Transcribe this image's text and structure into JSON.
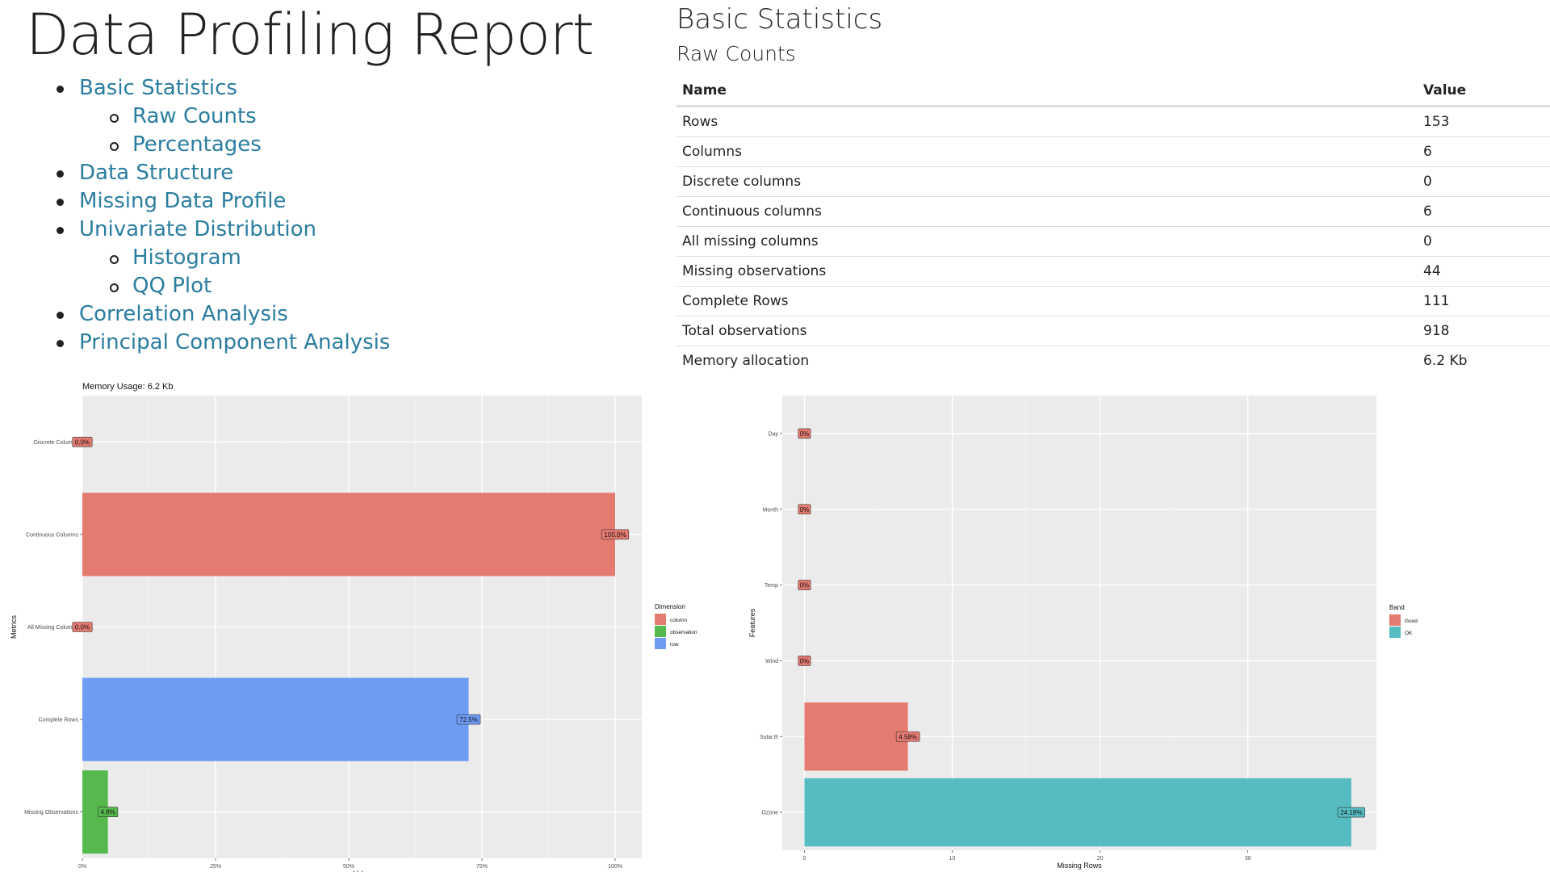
{
  "report": {
    "title": "Data Profiling Report"
  },
  "toc": [
    {
      "label": "Basic Statistics",
      "level": 1
    },
    {
      "label": "Raw Counts",
      "level": 2
    },
    {
      "label": "Percentages",
      "level": 2
    },
    {
      "label": "Data Structure",
      "level": 1
    },
    {
      "label": "Missing Data Profile",
      "level": 1
    },
    {
      "label": "Univariate Distribution",
      "level": 1
    },
    {
      "label": "Histogram",
      "level": 2
    },
    {
      "label": "QQ Plot",
      "level": 2
    },
    {
      "label": "Correlation Analysis",
      "level": 1
    },
    {
      "label": "Principal Component Analysis",
      "level": 1
    }
  ],
  "stats": {
    "heading": "Basic Statistics",
    "subheading": "Raw Counts",
    "columns": [
      "Name",
      "Value"
    ],
    "rows": [
      [
        "Rows",
        "153"
      ],
      [
        "Columns",
        "6"
      ],
      [
        "Discrete columns",
        "0"
      ],
      [
        "Continuous columns",
        "6"
      ],
      [
        "All missing columns",
        "0"
      ],
      [
        "Missing observations",
        "44"
      ],
      [
        "Complete Rows",
        "111"
      ],
      [
        "Total observations",
        "918"
      ],
      [
        "Memory allocation",
        "6.2 Kb"
      ]
    ]
  },
  "chart_data": [
    {
      "type": "bar",
      "orientation": "horizontal",
      "title": "Memory Usage: 6.2 Kb",
      "xlabel": "Value",
      "ylabel": "Metrics",
      "xlim": [
        0,
        1.05
      ],
      "x_ticks": [
        "0%",
        "25%",
        "50%",
        "75%",
        "100%"
      ],
      "x_tick_values": [
        0,
        0.25,
        0.5,
        0.75,
        1.0
      ],
      "categories": [
        "Discrete Columns",
        "Continuous Columns",
        "All Missing Columns",
        "Complete Rows",
        "Missing Observations"
      ],
      "values": [
        0.0,
        1.0,
        0.0,
        0.725,
        0.048
      ],
      "labels": [
        "0.0%",
        "100.0%",
        "0.0%",
        "72.5%",
        "4.8%"
      ],
      "groups": [
        "column",
        "column",
        "column",
        "row",
        "observation"
      ],
      "legend": {
        "title": "Dimension",
        "position": "right",
        "items": [
          {
            "name": "column",
            "color": "#E57A70"
          },
          {
            "name": "observation",
            "color": "#56B94D"
          },
          {
            "name": "row",
            "color": "#6E9CF5"
          }
        ]
      }
    },
    {
      "type": "bar",
      "orientation": "horizontal",
      "xlabel": "Missing Rows",
      "ylabel": "Features",
      "xlim": [
        -1.5,
        38.7
      ],
      "x_ticks": [
        "0",
        "10",
        "20",
        "30"
      ],
      "x_tick_values": [
        0,
        10,
        20,
        30
      ],
      "categories": [
        "Day",
        "Month",
        "Temp",
        "Wind",
        "Solar.R",
        "Ozone"
      ],
      "values": [
        0,
        0,
        0,
        0,
        7,
        37
      ],
      "labels": [
        "0%",
        "0%",
        "0%",
        "0%",
        "4.58%",
        "24.18%"
      ],
      "groups": [
        "Good",
        "Good",
        "Good",
        "Good",
        "Good",
        "OK"
      ],
      "legend": {
        "title": "Band",
        "position": "right",
        "items": [
          {
            "name": "Good",
            "color": "#E57A70"
          },
          {
            "name": "OK",
            "color": "#56BCC2"
          }
        ]
      }
    }
  ]
}
